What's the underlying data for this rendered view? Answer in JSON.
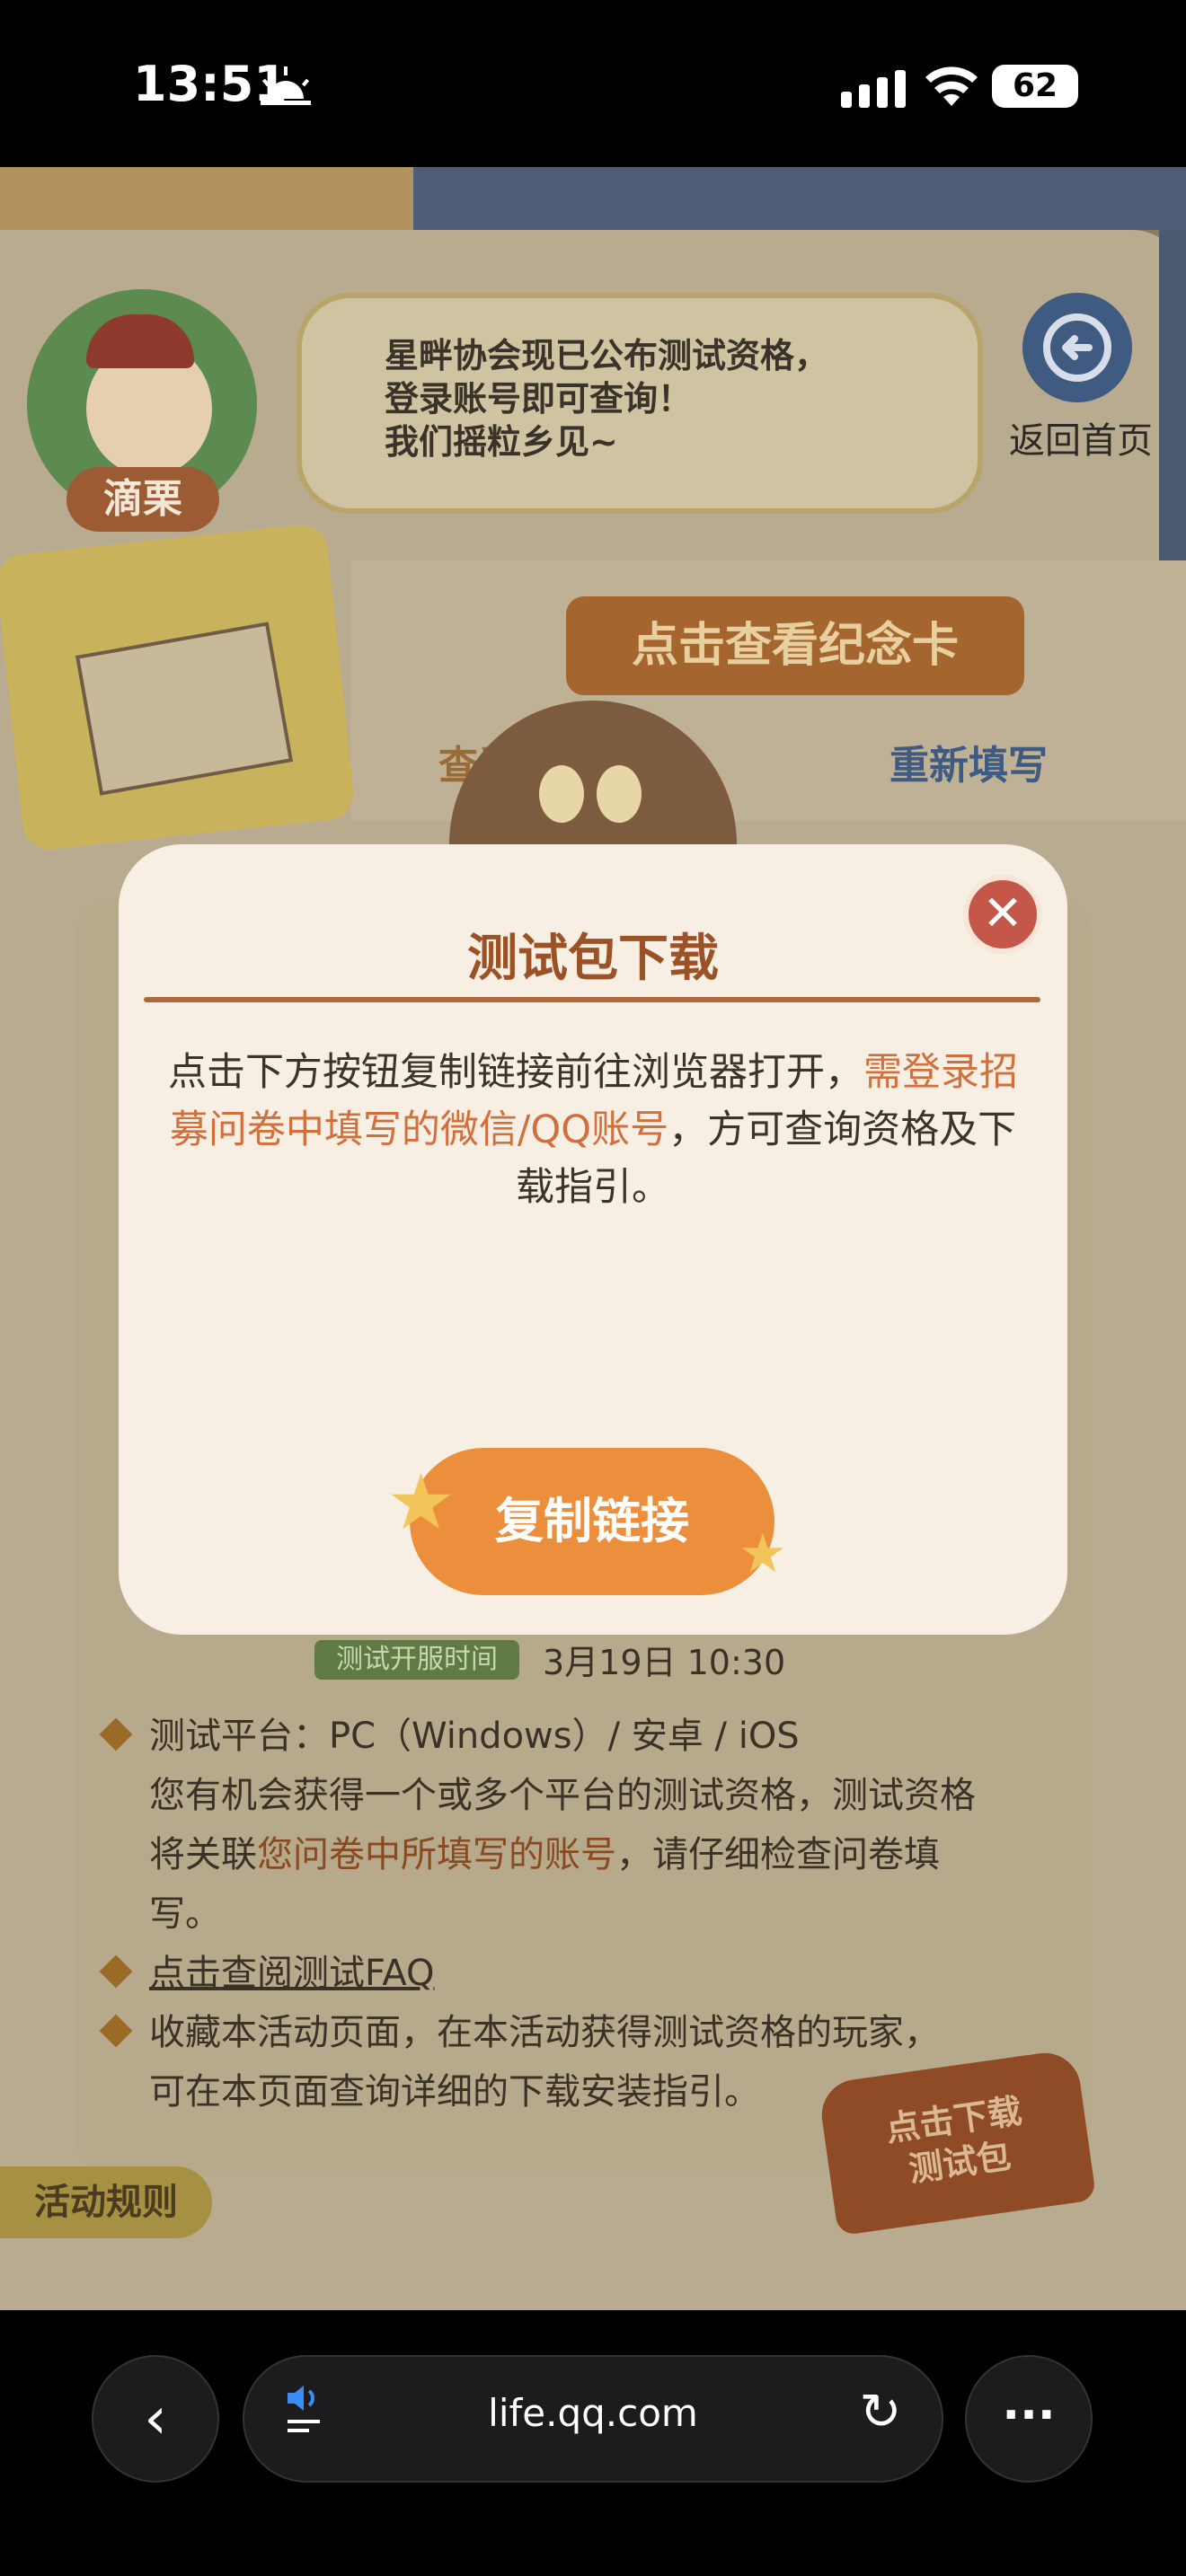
{
  "status_bar": {
    "time": "13:51",
    "battery": "62",
    "icons": [
      "sunrise-icon",
      "cellular-signal-icon",
      "wifi-icon",
      "battery-icon"
    ]
  },
  "header": {
    "character_name": "滴栗",
    "bubble_text": "星畔协会现已公布测试资格，\n登录账号即可查询！\n我们摇粒乡见~",
    "home_label": "返回首页"
  },
  "memorial": {
    "button_label": "点击查看纪念卡",
    "view_record": "查看填写记录",
    "refill": "重新填写"
  },
  "modal": {
    "title": "测试包下载",
    "desc_part1": "点击下方按钮复制链接前往浏览器打开，",
    "desc_highlight": "需登录招募问卷中填写的微信/QQ账号",
    "desc_part2": "，方可查询资格及下载指引。",
    "button_label": "复制链接",
    "close_label": "✕"
  },
  "info": {
    "open_time_tag": "测试开服时间",
    "open_time": "3月19日  10:30",
    "rules": {
      "platform": "测试平台：PC（Windows）/ 安卓 / iOS",
      "chance_line1": "您有机会获得一个或多个平台的测试资格，测试资格",
      "chance_line2_prefix": "将关联",
      "chance_line2_highlight": "您问卷中所填写的账号",
      "chance_line2_suffix": "，请仔细检查问卷填",
      "chance_line3": "写。",
      "faq_link": "点击查阅测试FAQ",
      "bookmark_line1": "收藏本活动页面，在本活动获得测试资格的玩家，",
      "bookmark_line2": "可在本页面查询详细的下载安装指引。"
    },
    "download_badge": "点击下载\n测试包",
    "rules_tab": "活动规则"
  },
  "browser": {
    "url": "life.qq.com",
    "back": "‹",
    "more": "···",
    "reload": "↻"
  },
  "colors": {
    "modal_bg": "#f7efe3",
    "title": "#9a5226",
    "highlight": "#d1703d",
    "button": "#ec8f3c"
  }
}
